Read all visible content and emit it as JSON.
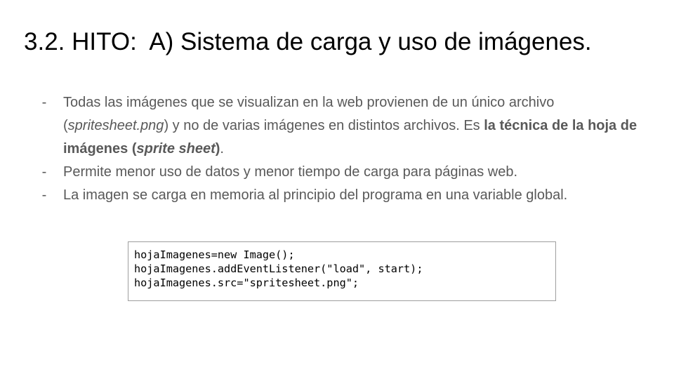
{
  "slide": {
    "title": "3.2. HITO:  A) Sistema de carga y uso de imágenes.",
    "bullet_marker": "-",
    "bullets": {
      "b1": {
        "part1": "Todas las imágenes que se visualizan en la web provienen de un único archivo (",
        "file_italic": "spritesheet.png",
        "part2": ") y no de varias imágenes en distintos archivos. Es ",
        "bold_part1": "la técnica de la hoja de imágenes (",
        "bold_italic": "sprite sheet",
        "bold_part2": ")",
        "end": "."
      },
      "b2": {
        "text": "Permite menor uso de datos y menor tiempo de carga para páginas web."
      },
      "b3": {
        "text": "La imagen se carga en memoria al principio del programa en una variable global."
      }
    },
    "code": {
      "lines": [
        "hojaImagenes=new Image();",
        "hojaImagenes.addEventListener(\"load\", start);",
        "hojaImagenes.src=\"spritesheet.png\";"
      ]
    }
  }
}
